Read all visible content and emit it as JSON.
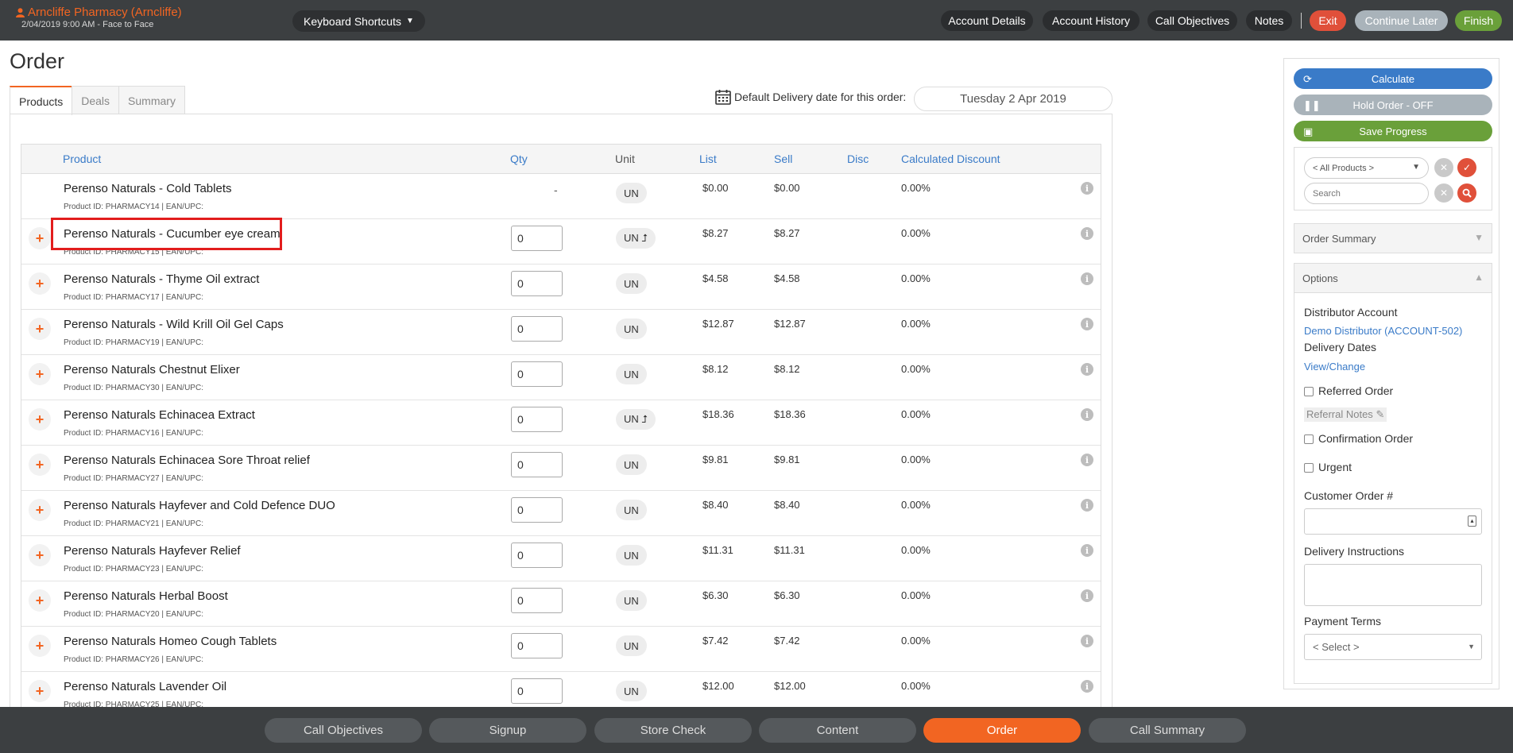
{
  "header": {
    "account_name": "Arncliffe Pharmacy (Arncliffe)",
    "account_sub": "2/04/2019 9:00 AM - Face to Face",
    "keyboard_shortcuts": "Keyboard Shortcuts",
    "buttons": {
      "account_details": "Account Details",
      "account_history": "Account History",
      "call_objectives": "Call Objectives",
      "notes": "Notes",
      "exit": "Exit",
      "continue_later": "Continue Later",
      "finish": "Finish"
    },
    "colors": {
      "exit": "#e0503a",
      "continue_later": "#a9b3ba",
      "finish": "#6aa03a",
      "accent": "#f26522"
    }
  },
  "page": {
    "title": "Order",
    "tabs": [
      "Products",
      "Deals",
      "Summary"
    ],
    "delivery_label": "Default Delivery date for this order:",
    "delivery_date": "Tuesday 2 Apr 2019"
  },
  "grid": {
    "columns": {
      "product": "Product",
      "qty": "Qty",
      "unit": "Unit",
      "list": "List",
      "sell": "Sell",
      "disc": "Disc",
      "calc": "Calculated Discount"
    },
    "rows": [
      {
        "name": "Perenso Naturals - Cold Tablets",
        "pid": "Product ID: PHARMACY14 | EAN/UPC:",
        "qty": "-",
        "unit": "UN",
        "list": "$0.00",
        "sell": "$0.00",
        "calc": "0.00%"
      },
      {
        "name": "Perenso Naturals - Cucumber eye cream",
        "pid": "Product ID: PHARMACY15 | EAN/UPC:",
        "qty": "0",
        "unit": "UN ⮥",
        "list": "$8.27",
        "sell": "$8.27",
        "calc": "0.00%"
      },
      {
        "name": "Perenso Naturals - Thyme Oil extract",
        "pid": "Product ID: PHARMACY17 | EAN/UPC:",
        "qty": "0",
        "unit": "UN",
        "list": "$4.58",
        "sell": "$4.58",
        "calc": "0.00%"
      },
      {
        "name": "Perenso Naturals - Wild Krill Oil Gel Caps",
        "pid": "Product ID: PHARMACY19 | EAN/UPC:",
        "qty": "0",
        "unit": "UN",
        "list": "$12.87",
        "sell": "$12.87",
        "calc": "0.00%"
      },
      {
        "name": "Perenso Naturals Chestnut Elixer",
        "pid": "Product ID: PHARMACY30 | EAN/UPC:",
        "qty": "0",
        "unit": "UN",
        "list": "$8.12",
        "sell": "$8.12",
        "calc": "0.00%"
      },
      {
        "name": "Perenso Naturals Echinacea Extract",
        "pid": "Product ID: PHARMACY16 | EAN/UPC:",
        "qty": "0",
        "unit": "UN ⮥",
        "list": "$18.36",
        "sell": "$18.36",
        "calc": "0.00%"
      },
      {
        "name": "Perenso Naturals Echinacea Sore Throat relief",
        "pid": "Product ID: PHARMACY27 | EAN/UPC:",
        "qty": "0",
        "unit": "UN",
        "list": "$9.81",
        "sell": "$9.81",
        "calc": "0.00%"
      },
      {
        "name": "Perenso Naturals Hayfever and Cold Defence DUO",
        "pid": "Product ID: PHARMACY21 | EAN/UPC:",
        "qty": "0",
        "unit": "UN",
        "list": "$8.40",
        "sell": "$8.40",
        "calc": "0.00%"
      },
      {
        "name": "Perenso Naturals Hayfever Relief",
        "pid": "Product ID: PHARMACY23 | EAN/UPC:",
        "qty": "0",
        "unit": "UN",
        "list": "$11.31",
        "sell": "$11.31",
        "calc": "0.00%"
      },
      {
        "name": "Perenso Naturals Herbal Boost",
        "pid": "Product ID: PHARMACY20 | EAN/UPC:",
        "qty": "0",
        "unit": "UN",
        "list": "$6.30",
        "sell": "$6.30",
        "calc": "0.00%"
      },
      {
        "name": "Perenso Naturals Homeo Cough Tablets",
        "pid": "Product ID: PHARMACY26 | EAN/UPC:",
        "qty": "0",
        "unit": "UN",
        "list": "$7.42",
        "sell": "$7.42",
        "calc": "0.00%"
      },
      {
        "name": "Perenso Naturals Lavender Oil",
        "pid": "Product ID: PHARMACY25 | EAN/UPC:",
        "qty": "0",
        "unit": "UN",
        "list": "$12.00",
        "sell": "$12.00",
        "calc": "0.00%"
      }
    ]
  },
  "sidebar": {
    "calculate": "Calculate",
    "hold_order": "Hold Order - OFF",
    "save_progress": "Save Progress",
    "product_filter": "< All Products >",
    "search_placeholder": "Search",
    "order_summary": "Order Summary",
    "options": "Options",
    "distributor_account_label": "Distributor Account",
    "distributor_account_value": "Demo Distributor (ACCOUNT-502)",
    "delivery_dates_label": "Delivery Dates",
    "delivery_dates_link": "View/Change",
    "referred_order": "Referred Order",
    "referral_notes": "Referral Notes",
    "confirmation_order": "Confirmation Order",
    "urgent": "Urgent",
    "customer_order_label": "Customer Order #",
    "delivery_instructions_label": "Delivery Instructions",
    "payment_terms_label": "Payment Terms",
    "payment_terms_value": "< Select >",
    "colors": {
      "calculate": "#3a7bc8",
      "hold": "#a9b3ba",
      "save": "#6aa03a"
    }
  },
  "bottom_nav": [
    "Call Objectives",
    "Signup",
    "Store Check",
    "Content",
    "Order",
    "Call Summary"
  ],
  "bottom_nav_active": "Order"
}
